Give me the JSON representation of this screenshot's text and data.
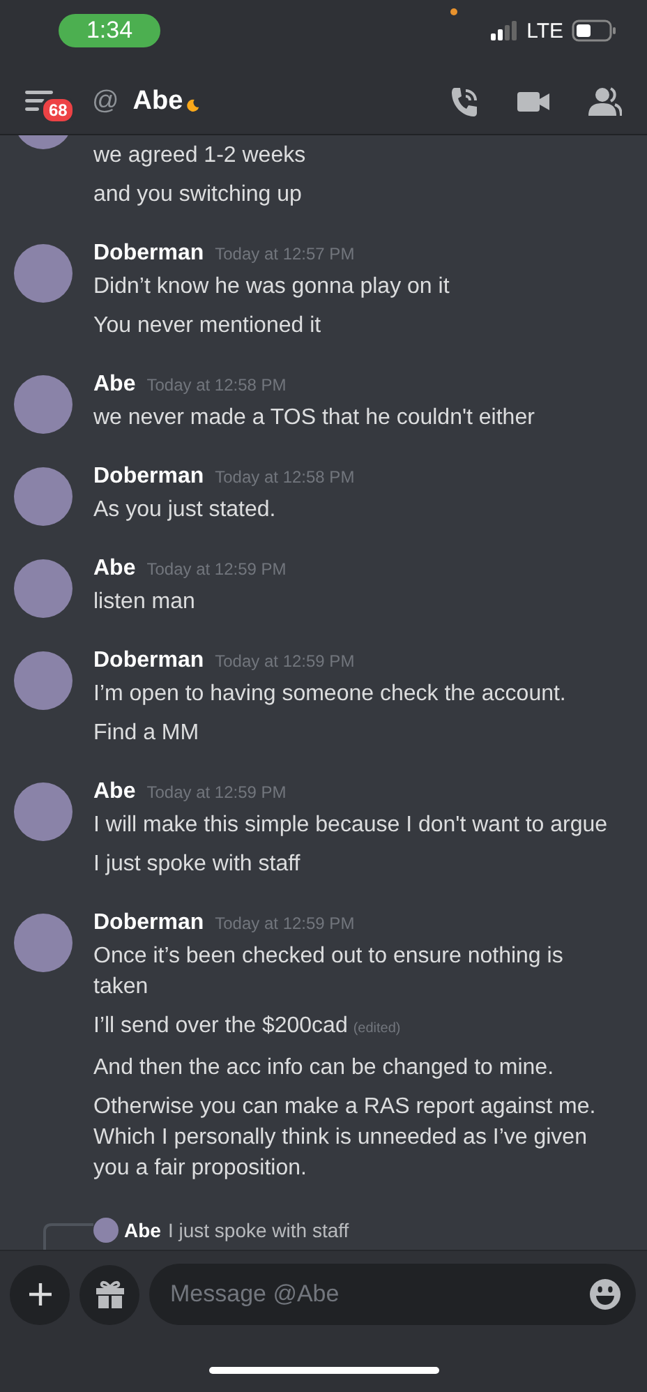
{
  "status_bar": {
    "time": "1:34",
    "network": "LTE"
  },
  "header": {
    "unread_count": "68",
    "at_sign": "@",
    "title": "Abe"
  },
  "messages": [
    {
      "kind": "continuation",
      "lines": [
        {
          "text": "we agreed 1-2 weeks"
        },
        {
          "text": "and you switching up"
        }
      ]
    },
    {
      "kind": "group",
      "author": "Doberman",
      "time": "Today at 12:57 PM",
      "lines": [
        {
          "text": "Didn’t know he was gonna play on it"
        },
        {
          "text": "You never mentioned it"
        }
      ]
    },
    {
      "kind": "group",
      "author": "Abe",
      "time": "Today at 12:58 PM",
      "lines": [
        {
          "text": "we never made a TOS that he couldn't either"
        }
      ]
    },
    {
      "kind": "group",
      "author": "Doberman",
      "time": "Today at 12:58 PM",
      "lines": [
        {
          "text": "As you just stated."
        }
      ]
    },
    {
      "kind": "group",
      "author": "Abe",
      "time": "Today at 12:59 PM",
      "lines": [
        {
          "text": "listen man"
        }
      ]
    },
    {
      "kind": "group",
      "author": "Doberman",
      "time": "Today at 12:59 PM",
      "lines": [
        {
          "text": "I’m open to having someone check the account."
        },
        {
          "text": "Find a MM"
        }
      ]
    },
    {
      "kind": "group",
      "author": "Abe",
      "time": "Today at 12:59 PM",
      "lines": [
        {
          "text": "I will make this simple because I don't want to argue"
        },
        {
          "text": "I just spoke with staff"
        }
      ]
    },
    {
      "kind": "group",
      "author": "Doberman",
      "time": "Today at 12:59 PM",
      "lines": [
        {
          "text": "Once it’s been checked out to ensure nothing is taken"
        },
        {
          "text": "I’ll send over the $200cad",
          "edited": "(edited)"
        },
        {
          "text": "And then the acc info can be changed to mine."
        },
        {
          "text": "Otherwise you can make a RAS report against me. Which I personally think is unneeded as I’ve given you a fair proposition."
        }
      ]
    },
    {
      "kind": "reply",
      "reply_author": "Abe",
      "reply_text": "I just spoke with staff"
    }
  ],
  "composer": {
    "placeholder": "Message @Abe"
  }
}
